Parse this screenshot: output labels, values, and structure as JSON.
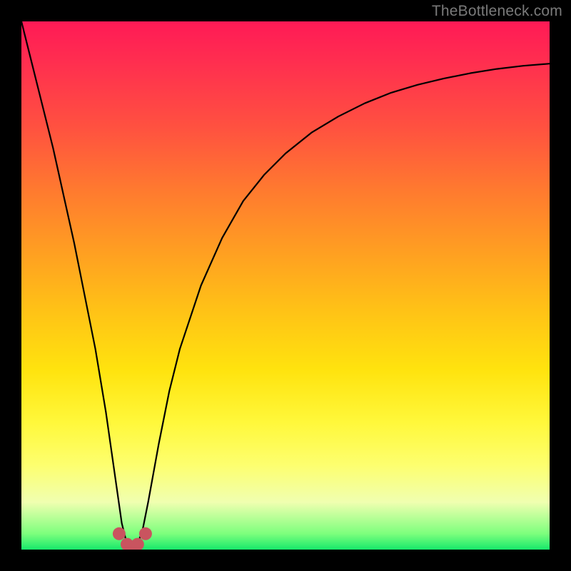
{
  "watermark": "TheBottleneck.com",
  "colors": {
    "background": "#000000",
    "gradient_top": "#ff1a56",
    "gradient_bottom": "#17e86b",
    "curve": "#000000",
    "marker": "#c9545f"
  },
  "chart_data": {
    "type": "line",
    "title": "",
    "xlabel": "",
    "ylabel": "",
    "xlim": [
      0,
      100
    ],
    "ylim": [
      0,
      100
    ],
    "x": [
      0,
      2,
      4,
      6,
      8,
      10,
      12,
      14,
      16,
      18,
      19,
      20,
      21,
      22,
      23,
      24,
      26,
      28,
      30,
      34,
      38,
      42,
      46,
      50,
      55,
      60,
      65,
      70,
      75,
      80,
      85,
      90,
      95,
      100
    ],
    "values": [
      100,
      92,
      84,
      76,
      67,
      58,
      48,
      38,
      26,
      12,
      5,
      1,
      0.5,
      1,
      4,
      9,
      20,
      30,
      38,
      50,
      59,
      66,
      71,
      75,
      79,
      82,
      84.5,
      86.5,
      88,
      89.2,
      90.2,
      91,
      91.6,
      92
    ],
    "markers_x": [
      18.5,
      20,
      21,
      22,
      23.5
    ],
    "markers_y": [
      3,
      1,
      0.5,
      1,
      3
    ],
    "min_x": 21,
    "curve_note": "V-shaped bottleneck curve; minimum near x≈21 at y≈0; left branch steep linear, right branch asymptotic toward ~92"
  }
}
